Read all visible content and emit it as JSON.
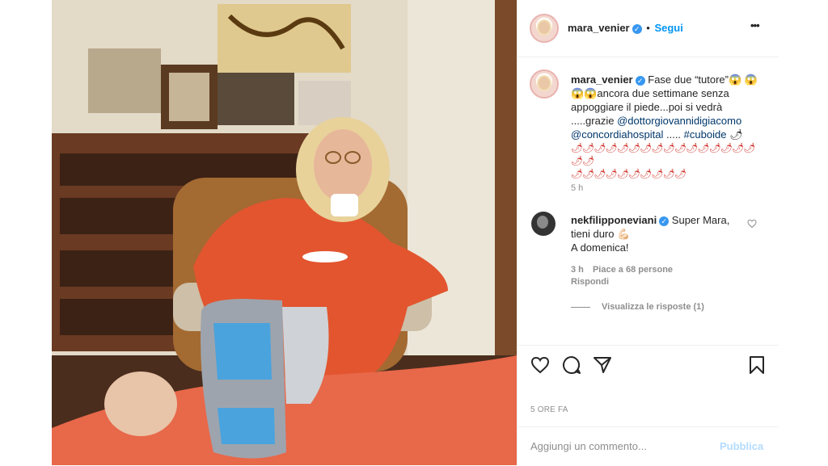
{
  "header": {
    "username": "mara_venier",
    "follow_label": "Segui",
    "more_label": "•••"
  },
  "caption": {
    "username": "mara_venier",
    "text_1": "Fase due “tutore”😱",
    "text_2": "😱😱😱ancora due settimane senza appoggiare il piede...poi si vedrà .....grazie ",
    "mention_1": "@dottorgiovannidigiacomo",
    "mention_2": "@concordiahospital",
    "text_3": " ..... ",
    "hashtag": "#cuboide",
    "text_4": " 🌶",
    "emoji_line_1": "🌶🌶🌶🌶🌶🌶🌶🌶🌶🌶🌶🌶🌶🌶🌶🌶🌶🌶",
    "emoji_line_2": "🌶🌶🌶🌶🌶🌶🌶🌶🌶🌶",
    "time": "5 h"
  },
  "comment": {
    "username": "nekfilipponeviani",
    "text": " Super Mara, tieni duro 💪🏻",
    "text_2": "A domenica!",
    "time": "3 h",
    "likes": "Piace a 68 persone",
    "reply": "Rispondi",
    "view_replies": "Visualizza le risposte (1)"
  },
  "actions": {
    "timestamp": "5 ORE FA"
  },
  "add_comment": {
    "placeholder": "Aggiungi un commento...",
    "publish_label": "Pubblica"
  },
  "colors": {
    "accent": "#0095f6",
    "verified": "#3897f0",
    "publish_disabled": "#b3dbff"
  }
}
